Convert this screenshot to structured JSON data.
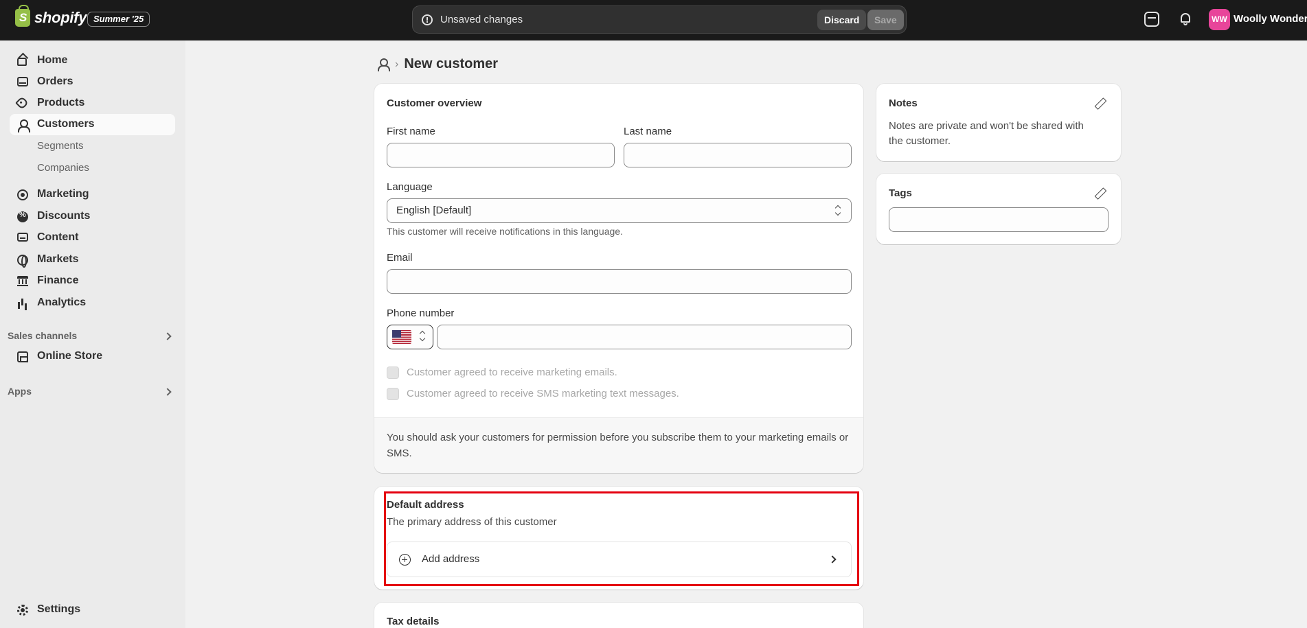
{
  "topbar": {
    "brand": "shopify",
    "edition": "Summer '25",
    "unsaved_text": "Unsaved changes",
    "discard_label": "Discard",
    "save_label": "Save",
    "avatar_initials": "WW",
    "store_name": "Woolly Wonders"
  },
  "sidebar": {
    "items": [
      {
        "label": "Home",
        "icon": "home-icon"
      },
      {
        "label": "Orders",
        "icon": "inbox-icon"
      },
      {
        "label": "Products",
        "icon": "tag-icon"
      },
      {
        "label": "Customers",
        "icon": "person-icon",
        "active": true
      },
      {
        "label": "Segments"
      },
      {
        "label": "Companies"
      },
      {
        "label": "Marketing",
        "icon": "target-icon"
      },
      {
        "label": "Discounts",
        "icon": "discount-icon"
      },
      {
        "label": "Content",
        "icon": "content-icon"
      },
      {
        "label": "Markets",
        "icon": "globe-icon"
      },
      {
        "label": "Finance",
        "icon": "bank-icon"
      },
      {
        "label": "Analytics",
        "icon": "bar-chart-icon"
      }
    ],
    "sales_channels_heading": "Sales channels",
    "online_store": "Online Store",
    "apps_heading": "Apps",
    "settings": "Settings"
  },
  "page": {
    "title": "New customer"
  },
  "overview": {
    "title": "Customer overview",
    "first_name_label": "First name",
    "first_name_value": "",
    "last_name_label": "Last name",
    "last_name_value": "",
    "language_label": "Language",
    "language_value": "English [Default]",
    "language_help": "This customer will receive notifications in this language.",
    "email_label": "Email",
    "email_value": "",
    "phone_label": "Phone number",
    "phone_value": "",
    "marketing_email_label": "Customer agreed to receive marketing emails.",
    "marketing_sms_label": "Customer agreed to receive SMS marketing text messages.",
    "footer_note": "You should ask your customers for permission before you subscribe them to your marketing emails or SMS."
  },
  "address": {
    "title": "Default address",
    "subtitle": "The primary address of this customer",
    "add_label": "Add address"
  },
  "tax": {
    "title": "Tax details"
  },
  "notes": {
    "title": "Notes",
    "body": "Notes are private and won't be shared with the customer."
  },
  "tags": {
    "title": "Tags",
    "value": ""
  },
  "colors": {
    "accent_highlight": "#e4000f",
    "avatar": "#e8459a",
    "topbar": "#1a1a1a"
  }
}
